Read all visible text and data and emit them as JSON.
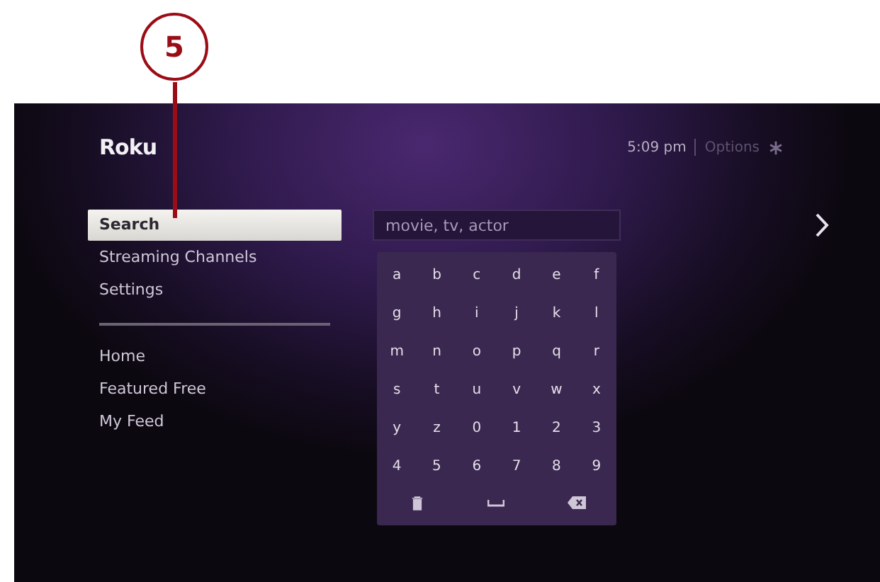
{
  "callout": {
    "number": "5"
  },
  "header": {
    "logo": "Roku",
    "time": "5:09 pm",
    "options": "Options"
  },
  "menu_groups": [
    [
      {
        "label": "Search",
        "selected": true
      },
      {
        "label": "Streaming Channels",
        "selected": false
      },
      {
        "label": "Settings",
        "selected": false
      }
    ],
    [
      {
        "label": "Home",
        "selected": false
      },
      {
        "label": "Featured Free",
        "selected": false
      },
      {
        "label": "My Feed",
        "selected": false
      }
    ]
  ],
  "search": {
    "placeholder": "movie, tv, actor"
  },
  "keys": [
    "a",
    "b",
    "c",
    "d",
    "e",
    "f",
    "g",
    "h",
    "i",
    "j",
    "k",
    "l",
    "m",
    "n",
    "o",
    "p",
    "q",
    "r",
    "s",
    "t",
    "u",
    "v",
    "w",
    "x",
    "y",
    "z",
    "0",
    "1",
    "2",
    "3",
    "4",
    "5",
    "6",
    "7",
    "8",
    "9"
  ],
  "special_keys": [
    {
      "kind": "clear"
    },
    {
      "kind": "space"
    },
    {
      "kind": "backspace"
    }
  ]
}
